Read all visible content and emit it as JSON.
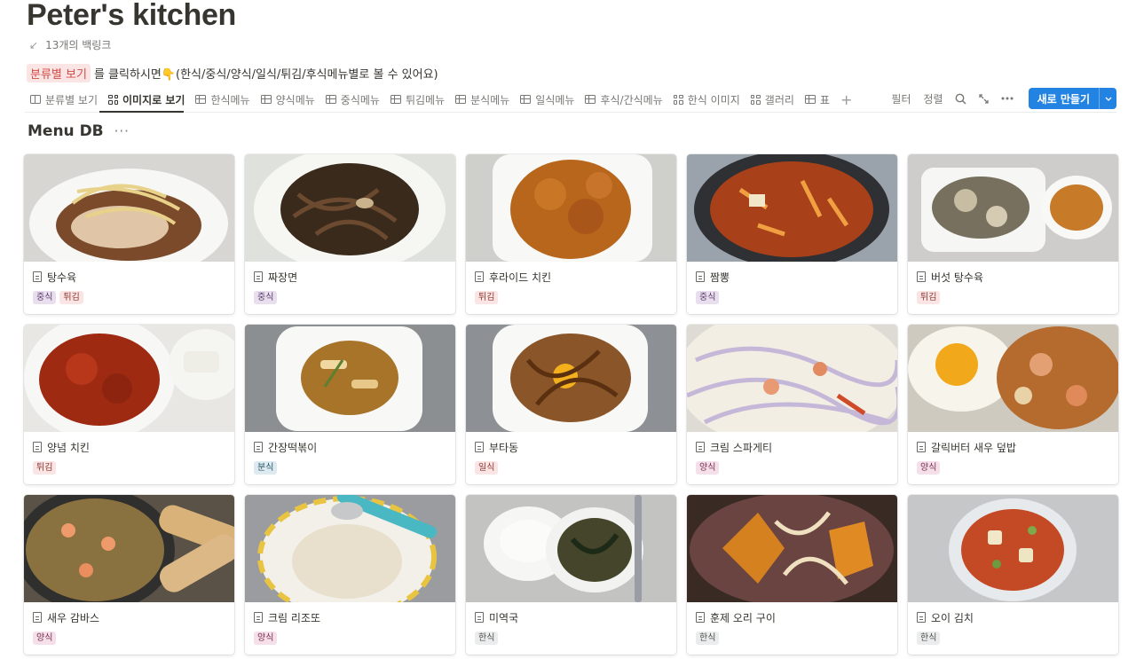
{
  "page": {
    "title": "Peter's kitchen",
    "backlinks": "13개의 백링크",
    "description_highlight": "분류별 보기",
    "description_rest": "를 클릭하시면👇(한식/중식/양식/일식/튀김/후식메뉴별로 볼 수 있어요)"
  },
  "tabs": [
    {
      "label": "분류별 보기",
      "icon": "board-icon"
    },
    {
      "label": "이미지로 보기",
      "icon": "gallery-icon",
      "active": true
    },
    {
      "label": "한식메뉴",
      "icon": "table-icon"
    },
    {
      "label": "양식메뉴",
      "icon": "table-icon"
    },
    {
      "label": "중식메뉴",
      "icon": "table-icon"
    },
    {
      "label": "튀김메뉴",
      "icon": "table-icon"
    },
    {
      "label": "분식메뉴",
      "icon": "table-icon"
    },
    {
      "label": "일식메뉴",
      "icon": "table-icon"
    },
    {
      "label": "후식/간식메뉴",
      "icon": "table-icon"
    },
    {
      "label": "한식 이미지",
      "icon": "gallery-icon"
    },
    {
      "label": "갤러리",
      "icon": "gallery-icon"
    },
    {
      "label": "표",
      "icon": "table-icon"
    }
  ],
  "toolbar": {
    "filter": "필터",
    "sort": "정렬",
    "new_button": "새로 만들기"
  },
  "database": {
    "title": "Menu DB"
  },
  "colors": {
    "accent": "#2383e2",
    "text": "#37352f",
    "muted": "#787774"
  },
  "cards": [
    {
      "title": "탕수육",
      "tags": [
        "중식",
        "튀김"
      ],
      "image": "sweet-sour-pork"
    },
    {
      "title": "짜장면",
      "tags": [
        "중식"
      ],
      "image": "jajangmyeon"
    },
    {
      "title": "후라이드 치킨",
      "tags": [
        "튀김"
      ],
      "image": "fried-chicken"
    },
    {
      "title": "짬뽕",
      "tags": [
        "중식"
      ],
      "image": "jjamppong"
    },
    {
      "title": "버섯 탕수육",
      "tags": [
        "튀김"
      ],
      "image": "mushroom-tangsuyuk"
    },
    {
      "title": "양념 치킨",
      "tags": [
        "튀김"
      ],
      "image": "yangnyeom-chicken"
    },
    {
      "title": "간장떡볶이",
      "tags": [
        "분식"
      ],
      "image": "soy-tteokbokki"
    },
    {
      "title": "부타동",
      "tags": [
        "일식"
      ],
      "image": "butadon"
    },
    {
      "title": "크림 스파게티",
      "tags": [
        "양식"
      ],
      "image": "cream-spaghetti"
    },
    {
      "title": "갈릭버터 새우 덮밥",
      "tags": [
        "양식"
      ],
      "image": "garlic-shrimp-bowl"
    },
    {
      "title": "새우 감바스",
      "tags": [
        "양식"
      ],
      "image": "gambas"
    },
    {
      "title": "크림 리조또",
      "tags": [
        "양식"
      ],
      "image": "cream-risotto"
    },
    {
      "title": "미역국",
      "tags": [
        "한식"
      ],
      "image": "seaweed-soup"
    },
    {
      "title": "훈제 오리 구이",
      "tags": [
        "한식"
      ],
      "image": "smoked-duck"
    },
    {
      "title": "오이 김치",
      "tags": [
        "한식"
      ],
      "image": "cucumber-kimchi"
    }
  ]
}
